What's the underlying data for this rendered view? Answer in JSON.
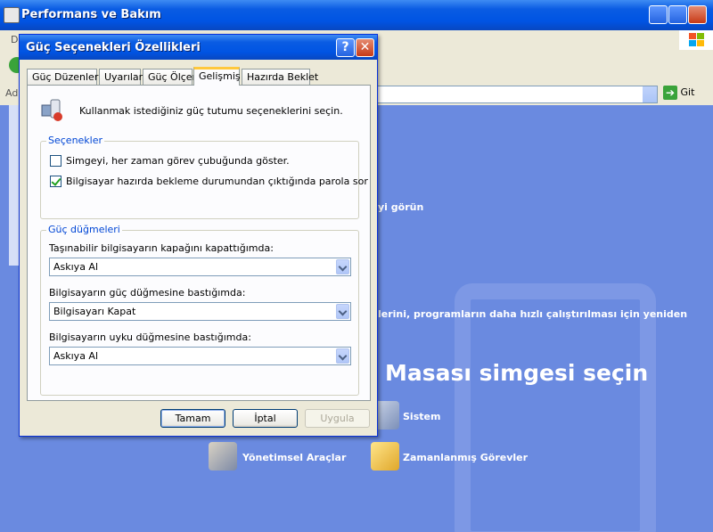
{
  "main_window": {
    "title": "Performans ve Bakım",
    "menu_partial": "De",
    "address_partial": "Ad",
    "go_label": "Git"
  },
  "background": {
    "link_partial_1": "yi görün",
    "link_partial_2": "lerini, programların daha hızlı çalıştırılması için yeniden",
    "heading": "Masası simgesi seçin",
    "items": [
      {
        "label": "Sistem",
        "icon": "system-icon"
      },
      {
        "label": "Yönetimsel Araçlar",
        "icon": "admin-tools-icon"
      },
      {
        "label": "Zamanlanmış Görevler",
        "icon": "scheduled-tasks-icon"
      }
    ]
  },
  "dialog": {
    "title": "Güç Seçenekleri Özellikleri",
    "tabs": [
      {
        "label": "Güç Düzenleri"
      },
      {
        "label": "Uyarılar"
      },
      {
        "label": "Güç Ölçer"
      },
      {
        "label": "Gelişmiş",
        "active": true
      },
      {
        "label": "Hazırda Beklet"
      }
    ],
    "intro": "Kullanmak istediğiniz güç tutumu seçeneklerini seçin.",
    "options_group": {
      "legend": "Seçenekler",
      "checkboxes": [
        {
          "label": "Simgeyi, her zaman görev çubuğunda göster.",
          "checked": false
        },
        {
          "label": "Bilgisayar hazırda bekleme durumundan çıktığında parola sor",
          "checked": true
        }
      ]
    },
    "power_buttons_group": {
      "legend": "Güç düğmeleri",
      "fields": [
        {
          "label": "Taşınabilir bilgisayarın kapağını kapattığımda:",
          "value": "Askıya Al"
        },
        {
          "label": "Bilgisayarın güç düğmesine bastığımda:",
          "value": "Bilgisayarı Kapat"
        },
        {
          "label": "Bilgisayarın uyku düğmesine bastığımda:",
          "value": "Askıya Al"
        }
      ]
    },
    "buttons": {
      "ok": "Tamam",
      "cancel": "İptal",
      "apply": "Uygula"
    }
  },
  "colors": {
    "titlebar": "#0054e3",
    "content_bg": "#6a8ae0",
    "dialog_bg": "#ece9d8",
    "group_legend": "#0046d5"
  }
}
